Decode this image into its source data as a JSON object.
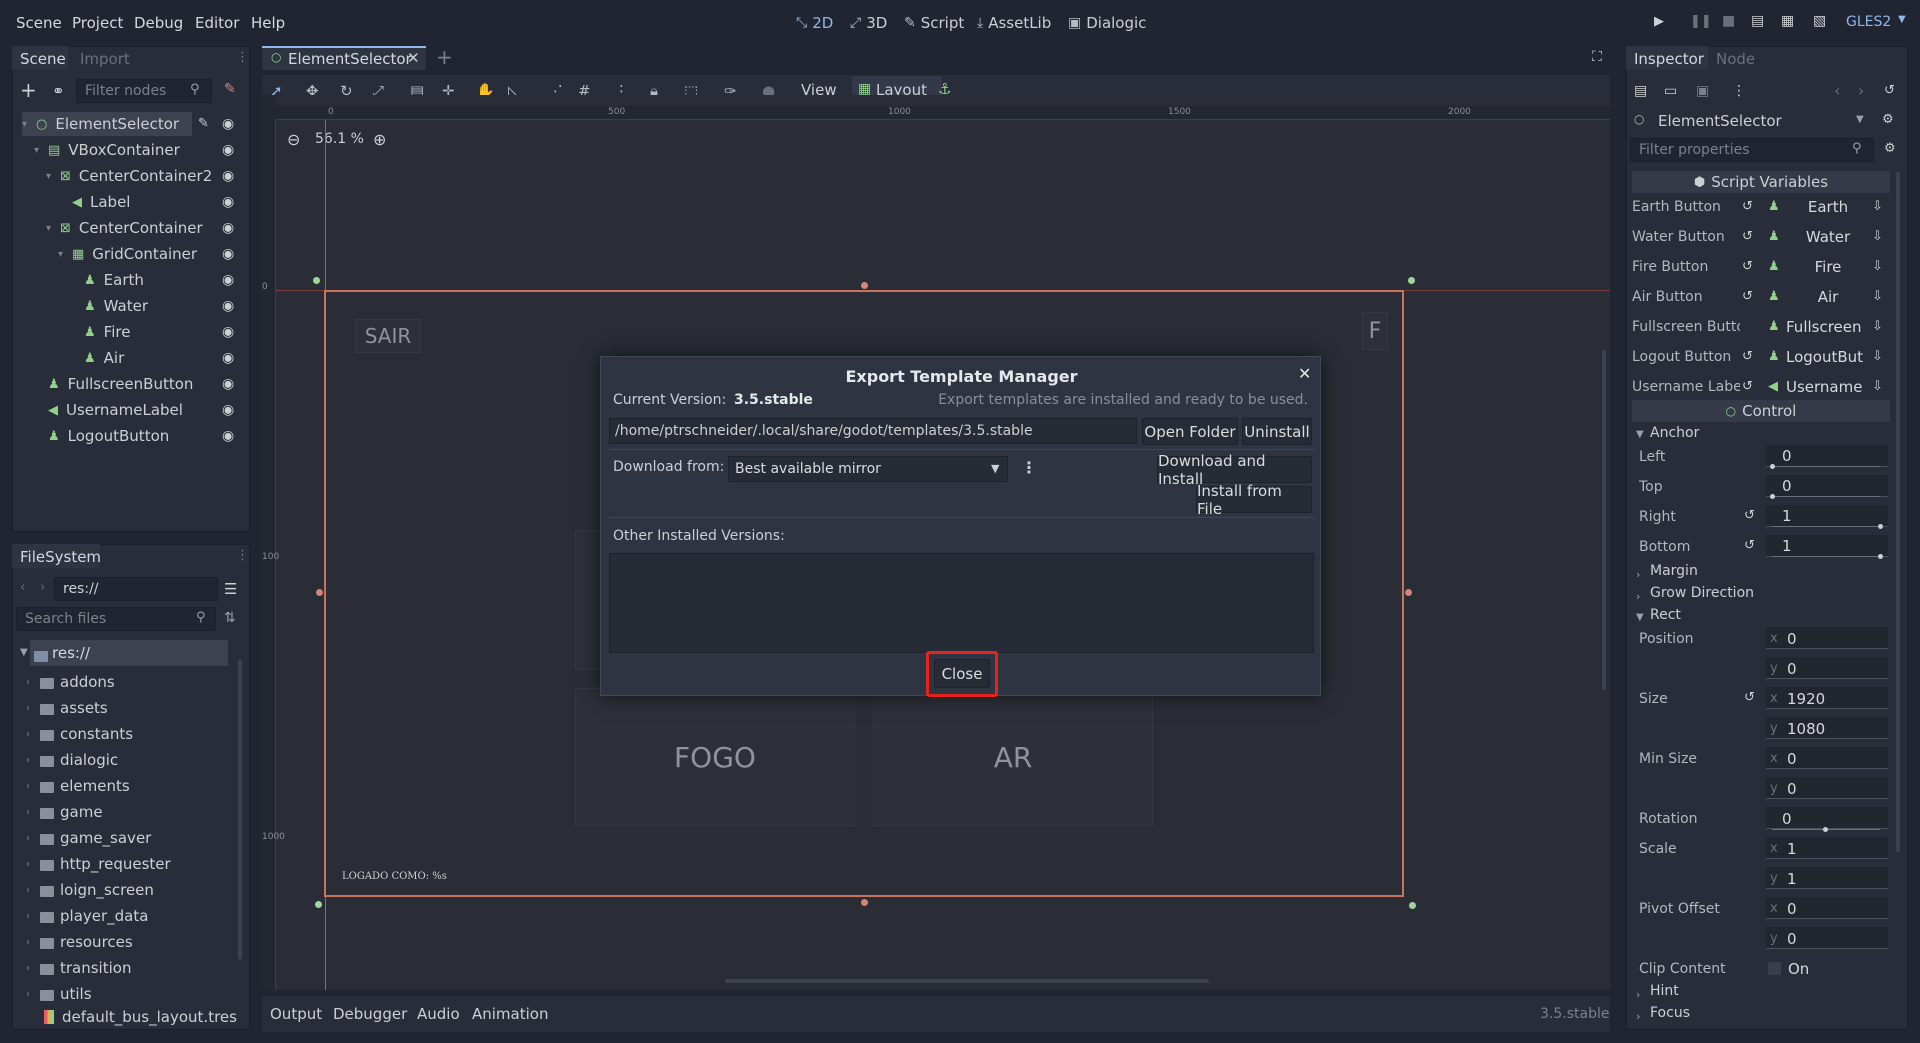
{
  "menubar": {
    "items": [
      "Scene",
      "Project",
      "Debug",
      "Editor",
      "Help"
    ],
    "workspaces": [
      "2D",
      "3D",
      "Script",
      "AssetLib",
      "Dialogic"
    ],
    "renderer": "GLES2"
  },
  "scene_panel": {
    "tabs": [
      "Scene",
      "Import"
    ],
    "filter_placeholder": "Filter nodes",
    "nodes": [
      {
        "label": "ElementSelector",
        "depth": 0,
        "icon": "control-icon"
      },
      {
        "label": "VBoxContainer",
        "depth": 1,
        "icon": "vbox-icon"
      },
      {
        "label": "CenterContainer2",
        "depth": 2,
        "icon": "center-container-icon"
      },
      {
        "label": "Label",
        "depth": 3,
        "icon": "label-icon"
      },
      {
        "label": "CenterContainer",
        "depth": 2,
        "icon": "center-container-icon"
      },
      {
        "label": "GridContainer",
        "depth": 3,
        "icon": "grid-container-icon"
      },
      {
        "label": "Earth",
        "depth": 4,
        "icon": "instance-icon"
      },
      {
        "label": "Water",
        "depth": 4,
        "icon": "instance-icon"
      },
      {
        "label": "Fire",
        "depth": 4,
        "icon": "instance-icon"
      },
      {
        "label": "Air",
        "depth": 4,
        "icon": "instance-icon"
      },
      {
        "label": "FullscreenButton",
        "depth": 1,
        "icon": "instance-icon"
      },
      {
        "label": "UsernameLabel",
        "depth": 1,
        "icon": "label-icon"
      },
      {
        "label": "LogoutButton",
        "depth": 1,
        "icon": "instance-icon"
      }
    ]
  },
  "filesystem": {
    "tab": "FileSystem",
    "path": "res://",
    "search_placeholder": "Search files",
    "root": "res://",
    "items": [
      "addons",
      "assets",
      "constants",
      "dialogic",
      "elements",
      "game",
      "game_saver",
      "http_requester",
      "loign_screen",
      "player_data",
      "resources",
      "transition",
      "utils"
    ],
    "file": "default_bus_layout.tres"
  },
  "editor": {
    "tab": "ElementSelector",
    "toolbar_view": "View",
    "toolbar_layout": "Layout",
    "zoom": "56.1 %",
    "ruler_h": [
      "0",
      "500",
      "1000",
      "1500",
      "2000"
    ],
    "ruler_v": [
      "0",
      "100",
      "1000"
    ],
    "canvas": {
      "sair": "SAIR",
      "f": "F",
      "fogo": "FOGO",
      "ar": "AR",
      "logged": "LOGADO COMO: %s"
    }
  },
  "dialog": {
    "title": "Export Template Manager",
    "current_version_label": "Current Version:",
    "current_version": "3.5.stable",
    "status": "Export templates are installed and ready to be used.",
    "path": "/home/ptrschneider/.local/share/godot/templates/3.5.stable",
    "open_folder": "Open Folder",
    "uninstall": "Uninstall",
    "download_from_label": "Download from:",
    "mirror": "Best available mirror",
    "download_install": "Download and Install",
    "install_file": "Install from File",
    "other_versions": "Other Installed Versions:",
    "close": "Close"
  },
  "bottom": {
    "tabs": [
      "Output",
      "Debugger",
      "Audio",
      "Animation"
    ],
    "version": "3.5.stable"
  },
  "inspector": {
    "tabs": [
      "Inspector",
      "Node"
    ],
    "node": "ElementSelector",
    "filter_placeholder": "Filter properties",
    "script_section": "Script Variables",
    "script_vars": [
      {
        "label": "Earth Button",
        "value": "Earth"
      },
      {
        "label": "Water Button",
        "value": "Water"
      },
      {
        "label": "Fire Button",
        "value": "Fire"
      },
      {
        "label": "Air Button",
        "value": "Air"
      },
      {
        "label": "Fullscreen Butto",
        "value": "Fullscreen"
      },
      {
        "label": "Logout Button",
        "value": "LogoutBut"
      },
      {
        "label": "Username Label",
        "value": "Username"
      }
    ],
    "control_section": "Control",
    "anchor_group": "Anchor",
    "anchor": [
      {
        "label": "Left",
        "value": "0"
      },
      {
        "label": "Top",
        "value": "0"
      },
      {
        "label": "Right",
        "value": "1"
      },
      {
        "label": "Bottom",
        "value": "1"
      }
    ],
    "margin_group": "Margin",
    "grow_group": "Grow Direction",
    "rect_group": "Rect",
    "position_label": "Position",
    "position": {
      "x": "0",
      "y": "0"
    },
    "size_label": "Size",
    "size": {
      "x": "1920",
      "y": "1080"
    },
    "min_size_label": "Min Size",
    "min_size": {
      "x": "0",
      "y": "0"
    },
    "rotation_label": "Rotation",
    "rotation": "0",
    "scale_label": "Scale",
    "scale": {
      "x": "1",
      "y": "1"
    },
    "pivot_label": "Pivot Offset",
    "pivot": {
      "x": "0",
      "y": "0"
    },
    "clip_label": "Clip Content",
    "clip_value": "On",
    "hint_group": "Hint",
    "focus_group": "Focus",
    "axis_x": "x",
    "axis_y": "y"
  },
  "colors": {
    "accent": "#8eb7ea",
    "highlight_box": "#e8241a",
    "canvas_border": "#c7745e",
    "node_green": "#8fd18a"
  }
}
